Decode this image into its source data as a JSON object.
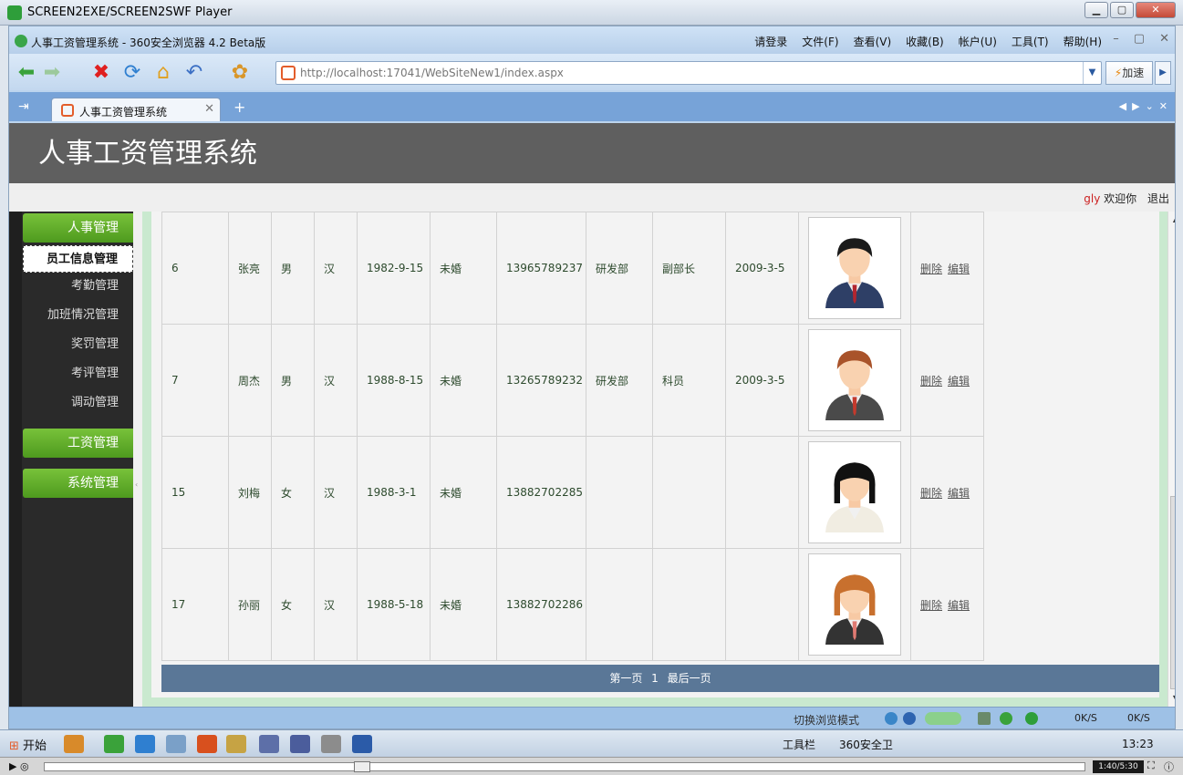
{
  "player": {
    "title": "SCREEN2EXE/SCREEN2SWF Player",
    "time_display": "1:40/5:30"
  },
  "browser": {
    "window_title": "人事工资管理系统 - 360安全浏览器 4.2 Beta版",
    "menu": [
      "请登录",
      "文件(F)",
      "查看(V)",
      "收藏(B)",
      "帐户(U)",
      "工具(T)",
      "帮助(H)"
    ],
    "address": "http://localhost:17041/WebSiteNew1/index.aspx",
    "speed_label": "加速",
    "tab_title": "人事工资管理系统",
    "status_mode": "切换浏览模式",
    "net_down": "0K/S",
    "net_up": "0K/S"
  },
  "site": {
    "title": "人事工资管理系统",
    "username": "gly",
    "welcome": "欢迎你",
    "logout": "退出"
  },
  "sidebar": {
    "hr_header": "人事管理",
    "hr_items": [
      "员工信息管理",
      "考勤管理",
      "加班情况管理",
      "奖罚管理",
      "考评管理",
      "调动管理"
    ],
    "salary_header": "工资管理",
    "system_header": "系统管理"
  },
  "employees": [
    {
      "id": "6",
      "name": "张亮",
      "gender": "男",
      "ethnicity": "汉",
      "birth": "1982-9-15",
      "marital": "未婚",
      "phone": "13965789237",
      "dept": "研发部",
      "title": "副部长",
      "hired": "2009-3-5",
      "avatar": "male-suit",
      "hair": "#1b1b1b",
      "shirt": "#2e3f66",
      "tie": "#b3262f"
    },
    {
      "id": "7",
      "name": "周杰",
      "gender": "男",
      "ethnicity": "汉",
      "birth": "1988-8-15",
      "marital": "未婚",
      "phone": "13265789232",
      "dept": "研发部",
      "title": "科员",
      "hired": "2009-3-5",
      "avatar": "brown-hair-suit",
      "hair": "#a9532a",
      "shirt": "#4a4a4a",
      "tie": "#c43a2d"
    },
    {
      "id": "15",
      "name": "刘梅",
      "gender": "女",
      "ethnicity": "汉",
      "birth": "1988-3-1",
      "marital": "未婚",
      "phone": "13882702285",
      "dept": "",
      "title": "",
      "hired": "",
      "avatar": "black-hair-woman",
      "hair": "#111111",
      "shirt": "#f1ede2",
      "tie": ""
    },
    {
      "id": "17",
      "name": "孙丽",
      "gender": "女",
      "ethnicity": "汉",
      "birth": "1988-5-18",
      "marital": "未婚",
      "phone": "13882702286",
      "dept": "",
      "title": "",
      "hired": "",
      "avatar": "woman-suit",
      "hair": "#c8702e",
      "shirt": "#333333",
      "tie": "#e07a72"
    }
  ],
  "row_actions": {
    "delete": "删除",
    "edit": "编辑"
  },
  "pager": {
    "first": "第一页",
    "current": "1",
    "last": "最后一页"
  },
  "taskbar": {
    "start": "开始",
    "toolbar_label": "工具栏",
    "security": "360安全卫",
    "clock": "13:23"
  },
  "colors": {
    "menu_green": "#5aa62a",
    "pager_blue": "#5a7797",
    "header_gray": "#5f5f5f",
    "content_green": "#c9e9cf"
  }
}
